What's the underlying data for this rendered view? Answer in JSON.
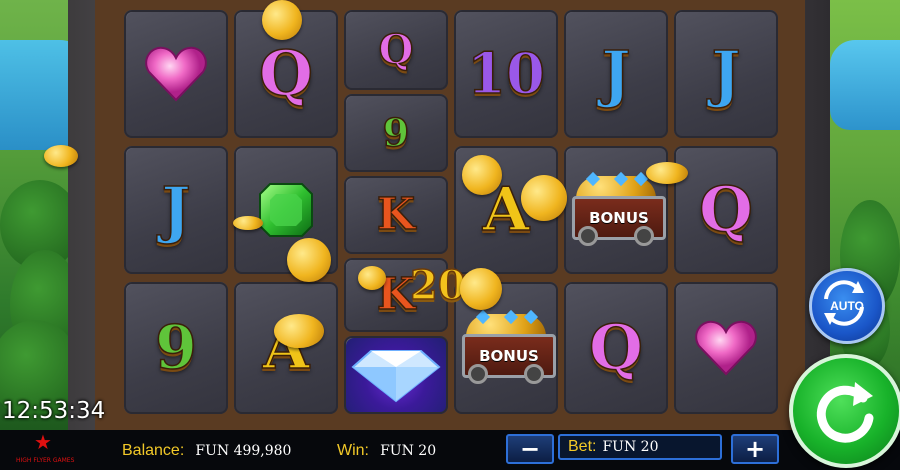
{
  "reels": {
    "row1": [
      "heart-symbol",
      "Q",
      "Q",
      "10",
      "J",
      "J"
    ],
    "row2": [
      "J",
      "emerald-symbol",
      "9",
      "A",
      "bonus-cart",
      "Q"
    ],
    "row3": [
      "9",
      "A",
      "K",
      "bonus-cart",
      "Q",
      "heart-symbol"
    ],
    "col3_extra": [
      "K",
      "diamond-symbol"
    ],
    "letters": {
      "q": "Q",
      "j": "J",
      "k": "K",
      "a": "A",
      "ten": "10",
      "nine": "9"
    },
    "bonus_label": "BONUS",
    "win_amount_on_reel": "20"
  },
  "clock": "12:53:34",
  "logo_text": "HIGH FLYER GAMES",
  "balance": {
    "label": "Balance:",
    "value": "FUN 499,980"
  },
  "win": {
    "label": "Win:",
    "value": "FUN 20"
  },
  "bet": {
    "label": "Bet:",
    "value": "FUN 20",
    "decrease": "−",
    "increase": "+"
  },
  "auto_label": "AUTO",
  "colors": {
    "accent_yellow": "#f2c928",
    "button_blue": "#2d6fd8",
    "spin_green": "#18b22a"
  }
}
